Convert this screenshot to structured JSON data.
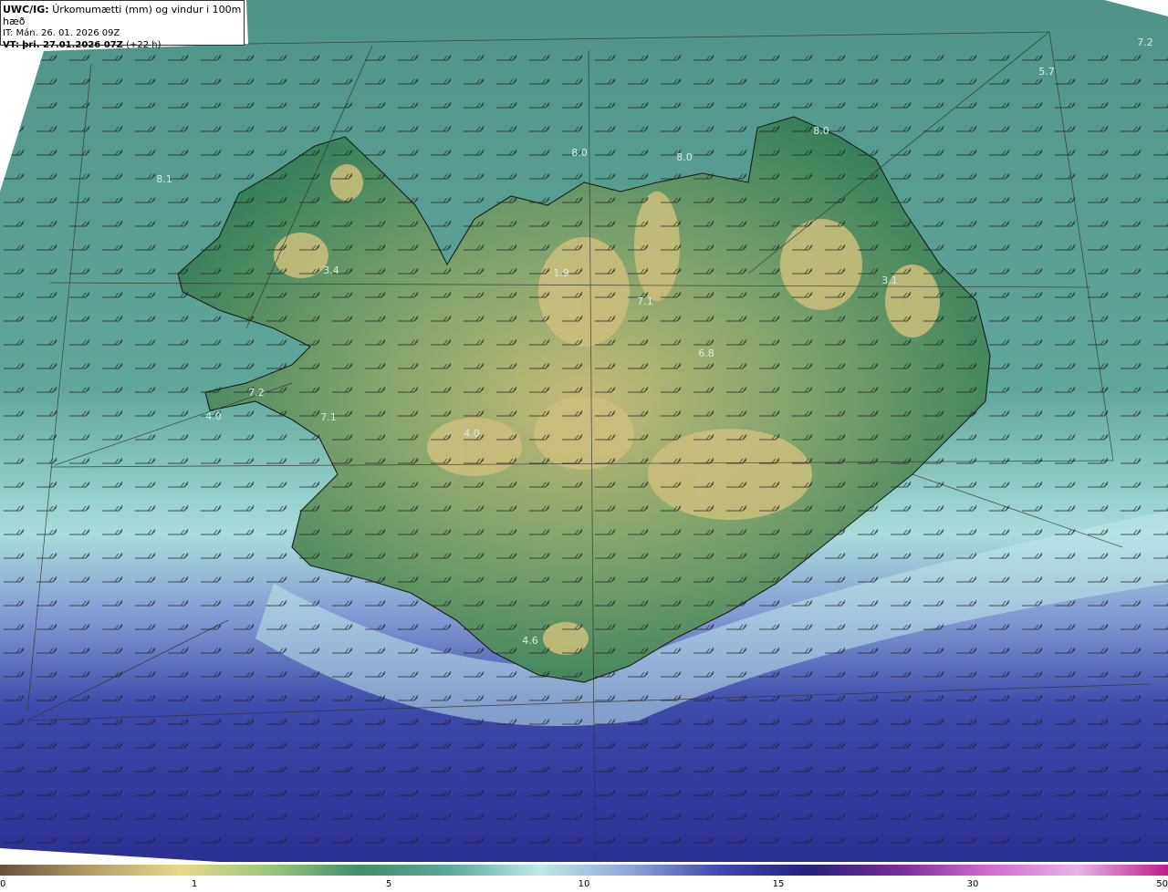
{
  "header": {
    "model": "UWC/IG:",
    "title": "Úrkomumætti (mm) og vindur i 100m hæð",
    "init_time": "IT: Mán. 26. 01. 2026 09Z",
    "valid_prefix": "VT:",
    "valid_time": "þri. 27.01.2026 07Z",
    "lead": "(+22 h)"
  },
  "map_values": [
    "7.2",
    "5.7",
    "8.0",
    "8.0",
    "8.0",
    "8.1",
    "3.4",
    "1.9",
    "7.1",
    "6.8",
    "3.1",
    "7.2",
    "4.0",
    "7.1",
    "4.0",
    "4.6"
  ],
  "colorbar": {
    "ticks": [
      "0",
      "1",
      "5",
      "10",
      "15",
      "30",
      "50"
    ],
    "colors": [
      "#6b4f3a",
      "#b59c66",
      "#e8d888",
      "#9cc77a",
      "#3f8f6a",
      "#5aa89a",
      "#bfe9e8",
      "#8fa6dc",
      "#3f49b0",
      "#26207e",
      "#7a2a9a",
      "#d56ad0",
      "#e8b2e6",
      "#c21a8a"
    ]
  },
  "legend_colors": {
    "land_low": "#2f7f5c",
    "land_high": "#c9c27e",
    "sea_north": "#66a69a",
    "sea_south": "#3641a3",
    "coast_light": "#c8ecec"
  }
}
